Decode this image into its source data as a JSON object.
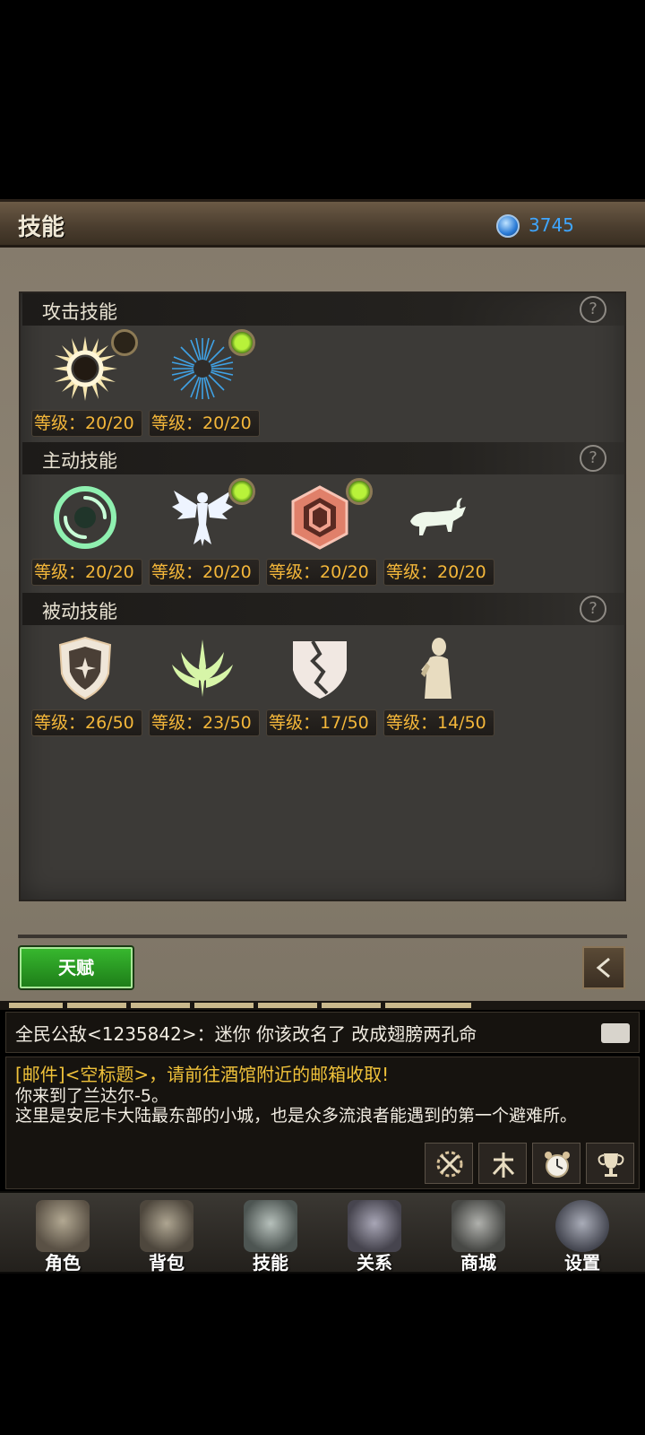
{
  "header": {
    "title": "技能",
    "currency_value": "3745"
  },
  "sections": [
    {
      "title": "攻击技能",
      "help": "?",
      "skills": [
        {
          "name": "sun-ring",
          "level": "等级：20/20",
          "badge": "off"
        },
        {
          "name": "blue-burst",
          "level": "等级：20/20",
          "badge": "on"
        }
      ]
    },
    {
      "title": "主动技能",
      "help": "?",
      "skills": [
        {
          "name": "vortex",
          "level": "等级：20/20",
          "badge": "none"
        },
        {
          "name": "winged-figure",
          "level": "等级：20/20",
          "badge": "on"
        },
        {
          "name": "hex-shield",
          "level": "等级：20/20",
          "badge": "on"
        },
        {
          "name": "ram",
          "level": "等级：20/20",
          "badge": "none"
        }
      ]
    },
    {
      "title": "被动技能",
      "help": "?",
      "skills": [
        {
          "name": "star-shield",
          "level": "等级：26/50",
          "badge": "none"
        },
        {
          "name": "claw-crest",
          "level": "等级：23/50",
          "badge": "none"
        },
        {
          "name": "cracked-shield",
          "level": "等级：17/50",
          "badge": "none"
        },
        {
          "name": "praying-figure",
          "level": "等级：14/50",
          "badge": "none"
        }
      ]
    }
  ],
  "actions": {
    "talent_label": "天赋"
  },
  "chat": {
    "line1": "全民公敌<1235842>：迷你  你该改名了 改成翅膀两孔命",
    "mail": "[邮件]<空标题>，请前往酒馆附近的邮箱收取!",
    "msg1": "你来到了兰达尔-5。",
    "msg2": "这里是安尼卡大陆最东部的小城，也是众多流浪者能遇到的第一个避难所。"
  },
  "nav": [
    {
      "label": "角色",
      "icon": "helmet-icon",
      "color": "#8a8070"
    },
    {
      "label": "背包",
      "icon": "bag-icon",
      "color": "#7d776a"
    },
    {
      "label": "技能",
      "icon": "spellbook-icon",
      "color": "#7c8a86"
    },
    {
      "label": "关系",
      "icon": "handshake-icon",
      "color": "#6e6c78"
    },
    {
      "label": "商城",
      "icon": "chest-icon",
      "color": "#6d6e6a"
    },
    {
      "label": "设置",
      "icon": "gear-icon",
      "color": "#6e7078"
    }
  ],
  "colors": {
    "level_text": "#f4b73a",
    "mail_text": "#f0c23a",
    "currency_text": "#3fa6ff",
    "talent_button": "#2aa024"
  }
}
